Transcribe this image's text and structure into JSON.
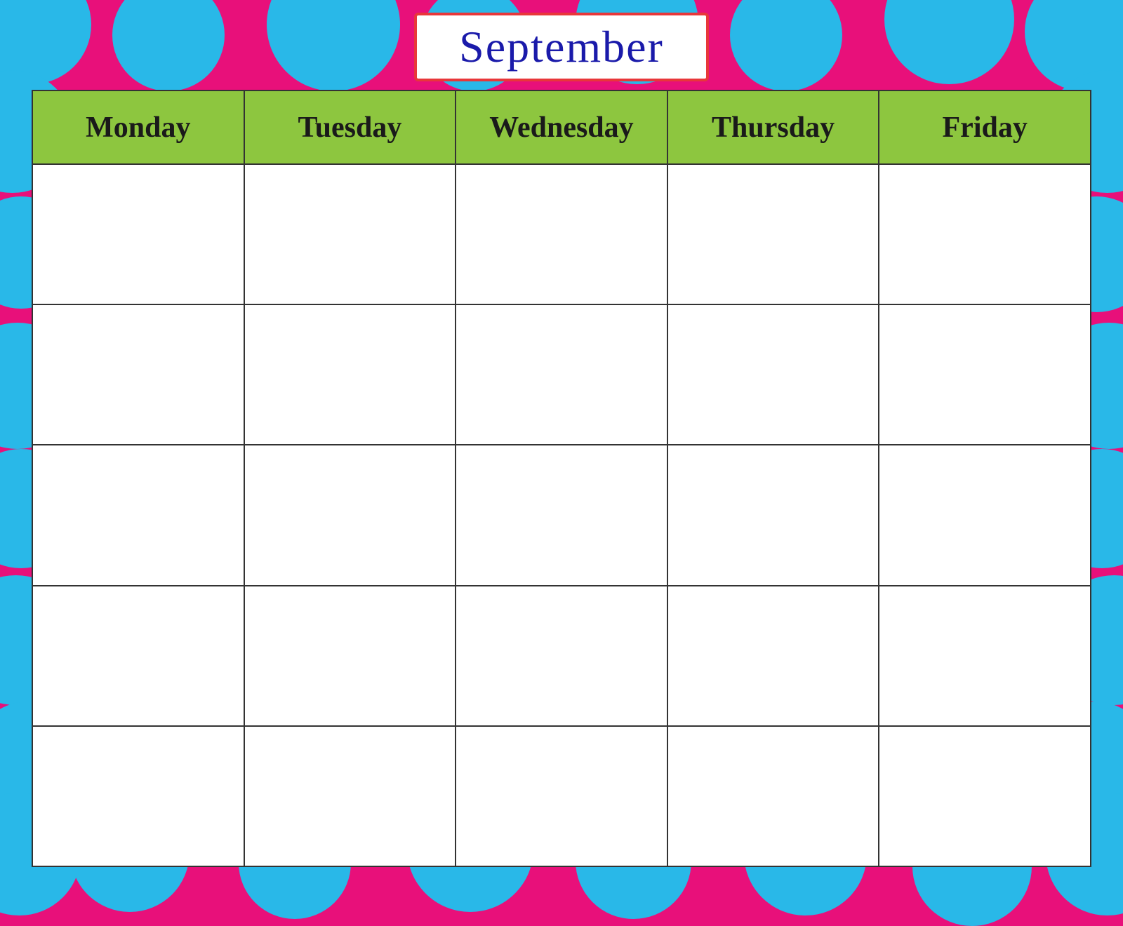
{
  "background": {
    "color": "#e8107a",
    "dot_color": "#29b8e8"
  },
  "header": {
    "month": "September",
    "border_color": "#e8373a"
  },
  "calendar": {
    "days": [
      "Monday",
      "Tuesday",
      "Wednesday",
      "Thursday",
      "Friday"
    ],
    "header_bg": "#8dc63f",
    "rows": 5,
    "cell_bg": "#ffffff"
  }
}
